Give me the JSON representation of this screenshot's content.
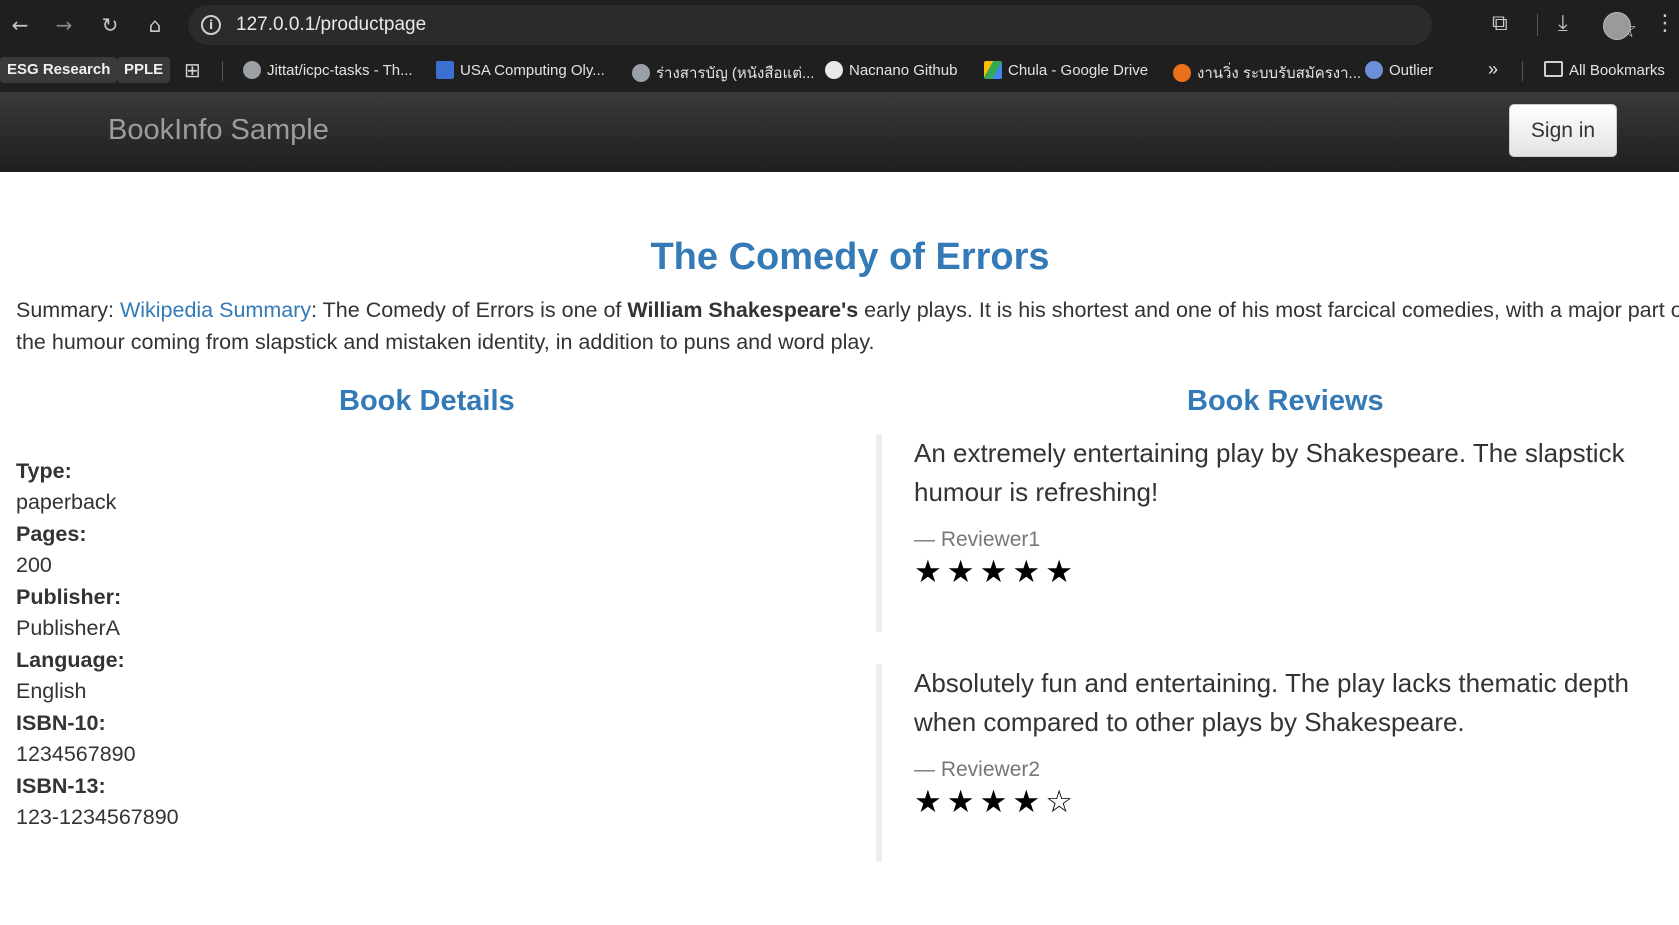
{
  "browser": {
    "url": "127.0.0.1/productpage",
    "bookmarks": [
      {
        "label": "ESG Research",
        "chip": true
      },
      {
        "label": "PPLE",
        "chip": true
      },
      {
        "label": "Jittat/icpc-tasks - Th..."
      },
      {
        "label": "USA Computing Oly..."
      },
      {
        "label": "ร่างสารบัญ (หนังสือแต่..."
      },
      {
        "label": "Nacnano Github"
      },
      {
        "label": "Chula - Google Drive"
      },
      {
        "label": "งานวิ่ง ระบบรับสมัครงา..."
      },
      {
        "label": "Outlier"
      }
    ],
    "more_label": "»",
    "all_bookmarks_label": "All Bookmarks"
  },
  "app": {
    "brand": "BookInfo Sample",
    "signin_label": "Sign in"
  },
  "book": {
    "title": "The Comedy of Errors",
    "summary_prefix": "Summary: ",
    "summary_link": "Wikipedia Summary",
    "summary_part1": ": The Comedy of Errors is one of ",
    "summary_bold": "William Shakespeare's",
    "summary_part2": " early plays. It is his shortest and one of his most farcical comedies, with a major part of the humour coming from slapstick and mistaken identity, in addition to puns and word play."
  },
  "details": {
    "heading": "Book Details",
    "items": [
      {
        "label": "Type:",
        "value": "paperback"
      },
      {
        "label": "Pages:",
        "value": "200"
      },
      {
        "label": "Publisher:",
        "value": "PublisherA"
      },
      {
        "label": "Language:",
        "value": "English"
      },
      {
        "label": "ISBN-10:",
        "value": "1234567890"
      },
      {
        "label": "ISBN-13:",
        "value": "123-1234567890"
      }
    ]
  },
  "reviews": {
    "heading": "Book Reviews",
    "items": [
      {
        "text": "An extremely entertaining play by Shakespeare. The slapstick humour is refreshing!",
        "reviewer": "— Reviewer1",
        "rating": 5,
        "max": 5
      },
      {
        "text": "Absolutely fun and entertaining. The play lacks thematic depth when compared to other plays by Shakespeare.",
        "reviewer": "— Reviewer2",
        "rating": 4,
        "max": 5
      }
    ]
  }
}
